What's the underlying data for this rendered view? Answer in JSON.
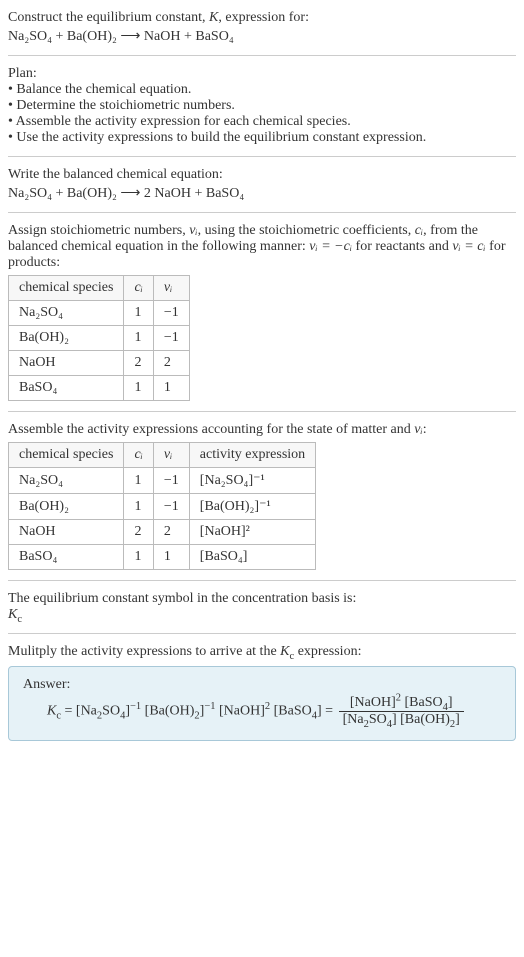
{
  "header": {
    "line1": "Construct the equilibrium constant, ",
    "K": "K",
    "line1b": ", expression for:",
    "eq": "Na₂SO₄ + Ba(OH)₂  ⟶  NaOH + BaSO₄"
  },
  "plan": {
    "title": "Plan:",
    "b1": "• Balance the chemical equation.",
    "b2": "• Determine the stoichiometric numbers.",
    "b3": "• Assemble the activity expression for each chemical species.",
    "b4": "• Use the activity expressions to build the equilibrium constant expression."
  },
  "balanced": {
    "title": "Write the balanced chemical equation:",
    "eq": "Na₂SO₄ + Ba(OH)₂  ⟶  2 NaOH + BaSO₄"
  },
  "stoich": {
    "intro1": "Assign stoichiometric numbers, ",
    "nu": "νᵢ",
    "intro2": ", using the stoichiometric coefficients, ",
    "ci": "cᵢ",
    "intro3": ", from the balanced chemical equation in the following manner: ",
    "rel1": "νᵢ = −cᵢ",
    "intro4": " for reactants and ",
    "rel2": "νᵢ = cᵢ",
    "intro5": " for products:",
    "headers": {
      "species": "chemical species",
      "c": "cᵢ",
      "nu": "νᵢ"
    },
    "rows": [
      {
        "sp": "Na₂SO₄",
        "c": "1",
        "nu": "−1"
      },
      {
        "sp": "Ba(OH)₂",
        "c": "1",
        "nu": "−1"
      },
      {
        "sp": "NaOH",
        "c": "2",
        "nu": "2"
      },
      {
        "sp": "BaSO₄",
        "c": "1",
        "nu": "1"
      }
    ]
  },
  "activity": {
    "title1": "Assemble the activity expressions accounting for the state of matter and ",
    "nu": "νᵢ",
    "title2": ":",
    "headers": {
      "species": "chemical species",
      "c": "cᵢ",
      "nu": "νᵢ",
      "act": "activity expression"
    },
    "rows": [
      {
        "sp": "Na₂SO₄",
        "c": "1",
        "nu": "−1",
        "act": "[Na₂SO₄]⁻¹"
      },
      {
        "sp": "Ba(OH)₂",
        "c": "1",
        "nu": "−1",
        "act": "[Ba(OH)₂]⁻¹"
      },
      {
        "sp": "NaOH",
        "c": "2",
        "nu": "2",
        "act": "[NaOH]²"
      },
      {
        "sp": "BaSO₄",
        "c": "1",
        "nu": "1",
        "act": "[BaSO₄]"
      }
    ]
  },
  "kc_symbol": {
    "line": "The equilibrium constant symbol in the concentration basis is:",
    "sym": "K_c"
  },
  "multiply": {
    "line1": "Mulitply the activity expressions to arrive at the ",
    "kc": "K_c",
    "line2": " expression:"
  },
  "answer": {
    "label": "Answer:",
    "lhs": "K_c = [Na₂SO₄]⁻¹ [Ba(OH)₂]⁻¹ [NaOH]² [BaSO₄] = ",
    "num": "[NaOH]² [BaSO₄]",
    "den": "[Na₂SO₄] [Ba(OH)₂]"
  }
}
